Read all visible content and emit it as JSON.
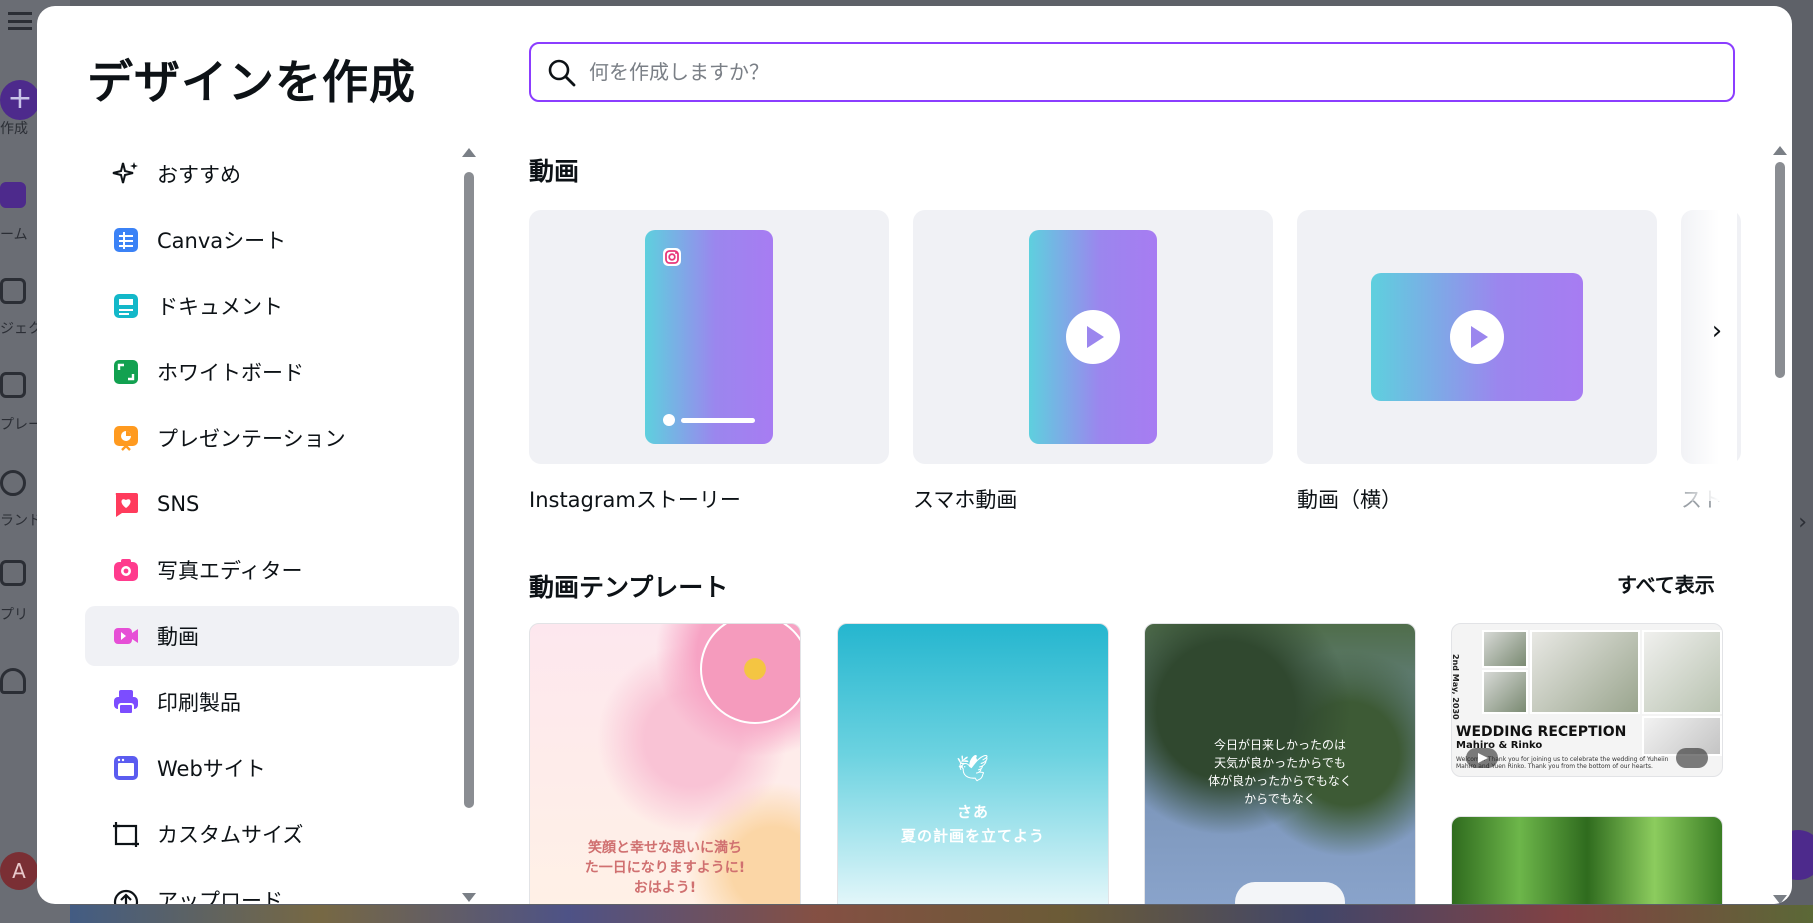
{
  "modal": {
    "title": "デザインを作成",
    "search_placeholder": "何を作成しますか？"
  },
  "nav": {
    "items": [
      {
        "label": "おすすめ",
        "icon": "sparkle-icon",
        "color": "#0d1216"
      },
      {
        "label": "Canvaシート",
        "icon": "sheet-icon",
        "color": "#3b82f6"
      },
      {
        "label": "ドキュメント",
        "icon": "document-icon",
        "color": "#13b8c9"
      },
      {
        "label": "ホワイトボード",
        "icon": "whiteboard-icon",
        "color": "#12a150"
      },
      {
        "label": "プレゼンテーション",
        "icon": "presentation-icon",
        "color": "#ff9a1f"
      },
      {
        "label": "SNS",
        "icon": "heart-icon",
        "color": "#ff3b5c"
      },
      {
        "label": "写真エディター",
        "icon": "camera-icon",
        "color": "#ff3b8d"
      },
      {
        "label": "動画",
        "icon": "video-icon",
        "color": "#e64fd6",
        "active": true
      },
      {
        "label": "印刷製品",
        "icon": "printer-icon",
        "color": "#7c4dff"
      },
      {
        "label": "Webサイト",
        "icon": "website-icon",
        "color": "#5b5cf0"
      },
      {
        "label": "カスタムサイズ",
        "icon": "custom-size-icon",
        "color": "#0d1216"
      },
      {
        "label": "アップロード",
        "icon": "upload-icon",
        "color": "#0d1216"
      }
    ]
  },
  "video_section": {
    "title": "動画",
    "cards": [
      {
        "label": "Instagramストーリー"
      },
      {
        "label": "スマホ動画"
      },
      {
        "label": "動画（横）"
      },
      {
        "label": "スト"
      }
    ]
  },
  "template_section": {
    "title": "動画テンプレート",
    "see_all": "すべて表示",
    "templates": [
      {
        "caption": "笑顔と幸せな思いに満ち\nた一日になりますように!\nおはよう!"
      },
      {
        "caption": "さあ\n夏の計画を立てよう"
      },
      {
        "caption": "今日が日来しかったのは\n天気が良かったからでも\n体が良かったからでもなく\nからでもなく"
      },
      {
        "caption": "WEDDING RECEPTION",
        "subcaption": "Mahiro & Rinko",
        "date": "2nd May, 2030",
        "small": "Welcome! Thank you for joining us to celebrate the wedding of Yuheiin Mahiro and Yuen Rinko. Thank you from the bottom of our hearts."
      },
      {
        "caption": ""
      }
    ]
  },
  "background": {
    "rail_labels": [
      "作成",
      "ーム",
      "ジェク",
      "プレー",
      "ランド",
      "プリ"
    ],
    "avatar_letter": "A"
  },
  "colors": {
    "accent": "#8b3dff",
    "gradient_start": "#5ed0de",
    "gradient_end": "#a77cf2"
  }
}
